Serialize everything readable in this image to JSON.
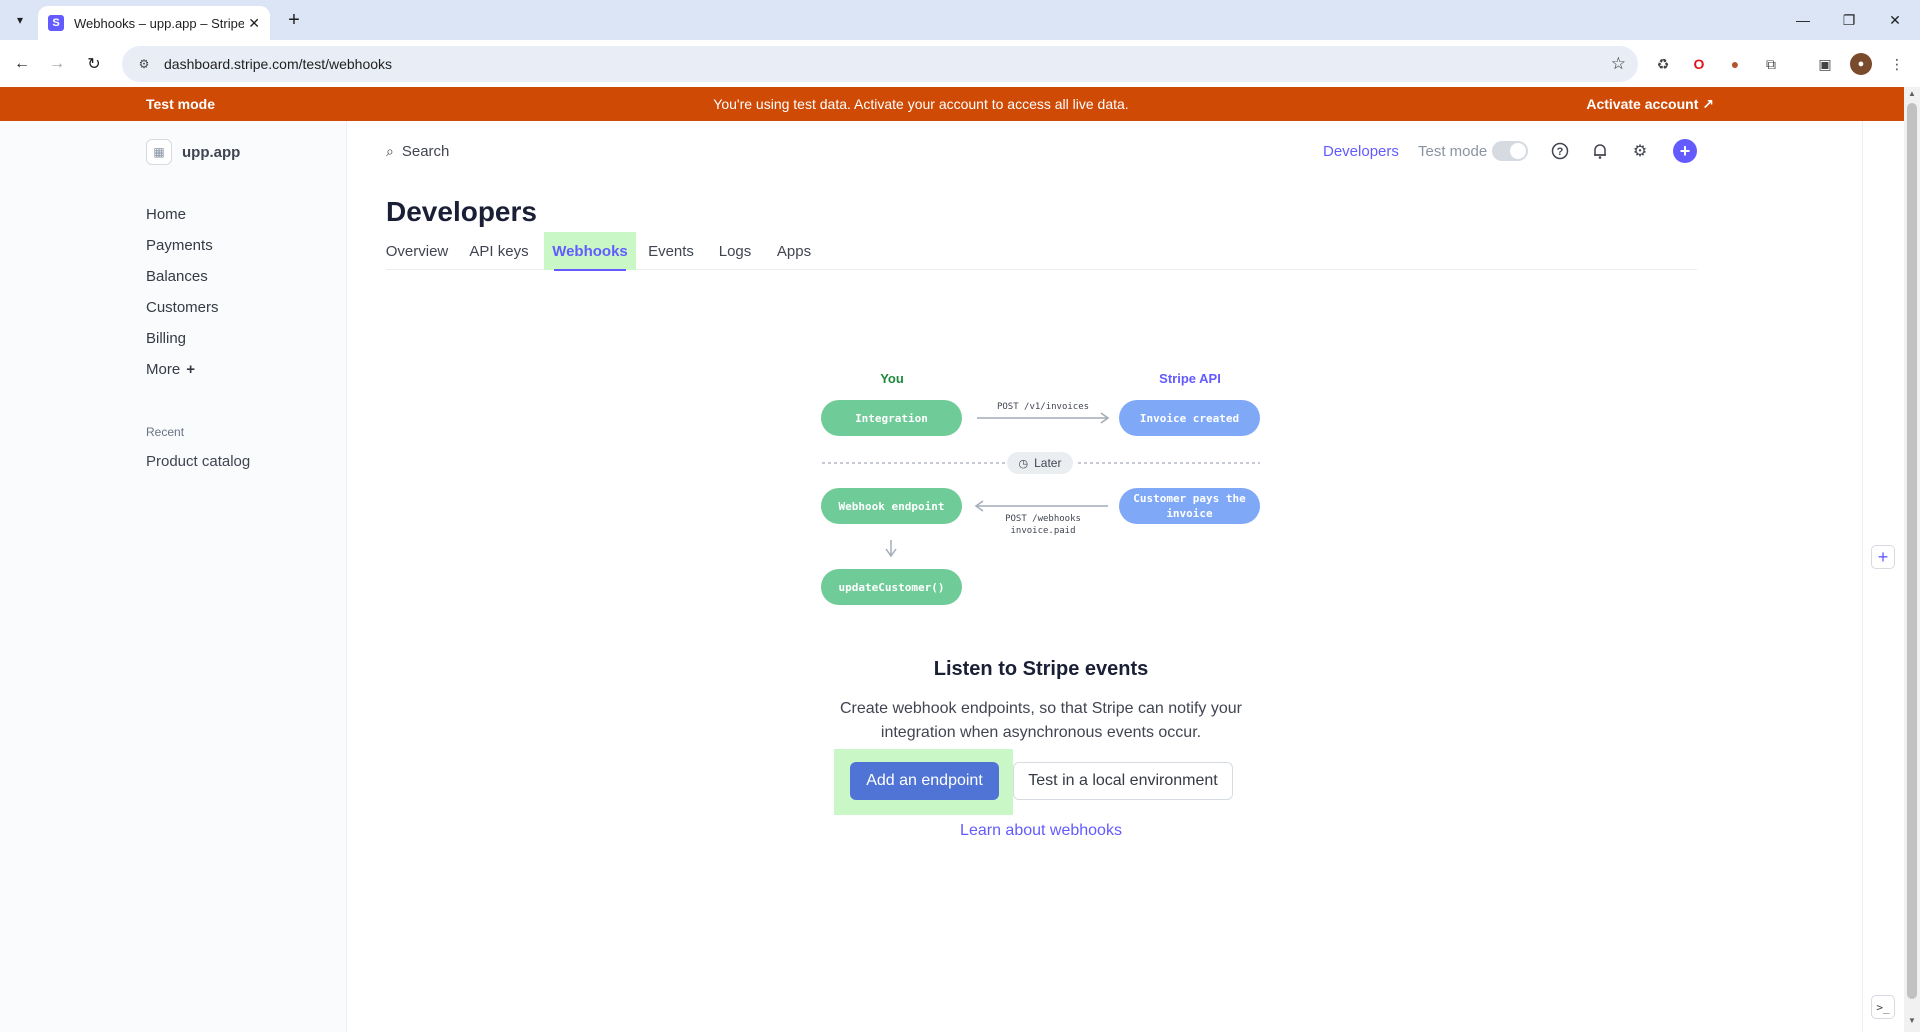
{
  "browser": {
    "tab_title": "Webhooks – upp.app – Stripe [Test]",
    "tab_favicon": "S",
    "url": "dashboard.stripe.com/test/webhooks"
  },
  "banner": {
    "left": "Test mode",
    "message": "You're using test data. Activate your account to access all live data.",
    "action": "Activate account ↗",
    "color": "#cf4a05"
  },
  "sidebar": {
    "account_name": "upp.app",
    "items": [
      {
        "label": "Home"
      },
      {
        "label": "Payments"
      },
      {
        "label": "Balances"
      },
      {
        "label": "Customers"
      },
      {
        "label": "Billing"
      },
      {
        "label": "More",
        "icon": "+"
      }
    ],
    "recent_label": "Recent",
    "recent_items": [
      {
        "label": "Product catalog"
      }
    ]
  },
  "topbar": {
    "search_label": "Search",
    "developers": "Developers",
    "test_mode": "Test mode",
    "test_mode_on": false
  },
  "page": {
    "title": "Developers",
    "tabs": [
      {
        "label": "Overview"
      },
      {
        "label": "API keys"
      },
      {
        "label": "Webhooks",
        "active": true
      },
      {
        "label": "Events"
      },
      {
        "label": "Logs"
      },
      {
        "label": "Apps"
      }
    ]
  },
  "diagram": {
    "you_label": "You",
    "stripe_label": "Stripe API",
    "integration": "Integration",
    "invoice_created": "Invoice created",
    "request_note": "POST /v1/invoices",
    "later": "Later",
    "webhook_endpoint": "Webhook endpoint",
    "customer_pays": "Customer pays the invoice",
    "webhook_note_line1": "POST /webhooks",
    "webhook_note_line2": "invoice.paid",
    "update_customer": "updateCustomer()",
    "colors": {
      "green": "#6fcb98",
      "blue": "#7fa8f7",
      "you_label": "#1e8a3c",
      "stripe_label": "#635bff"
    }
  },
  "empty_state": {
    "title": "Listen to Stripe events",
    "description": "Create webhook endpoints, so that Stripe can notify your integration when asynchronous events occur.",
    "primary_button": "Add an endpoint",
    "secondary_button": "Test in a local environment",
    "learn_link": "Learn about webhooks"
  },
  "theme": {
    "accent": "#635bff",
    "highlight": "#c9f7c5"
  }
}
